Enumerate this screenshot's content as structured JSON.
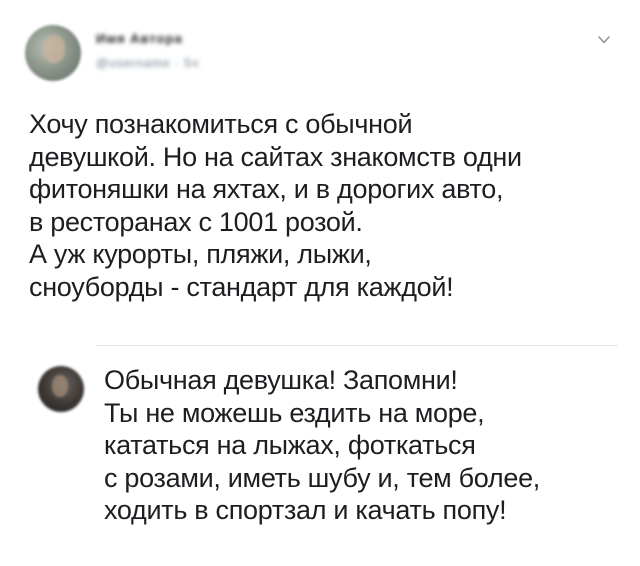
{
  "tweet": {
    "author_name": "Имя Автора",
    "author_handle": "@username · 5ч",
    "menu_icon": "chevron-down-icon",
    "lines": [
      "Хочу познакомиться с обычной",
      "девушкой. Но на сайтах знакомств одни",
      "фитоняшки на яхтах, и в дорогих авто,",
      "в ресторанах с 1001 розой.",
      "А уж курорты, пляжи, лыжи,",
      "сноуборды - стандарт для каждой!"
    ]
  },
  "reply": {
    "lines": [
      "Обычная девушка! Запомни!",
      "Ты не можешь ездить на море,",
      "кататься на лыжах, фоткаться",
      "с розами, иметь шубу и, тем более,",
      "ходить в спортзал и качать попу!"
    ]
  },
  "colors": {
    "text": "#1c1e21",
    "divider": "#e1e4e8",
    "icon": "#8899a6"
  }
}
